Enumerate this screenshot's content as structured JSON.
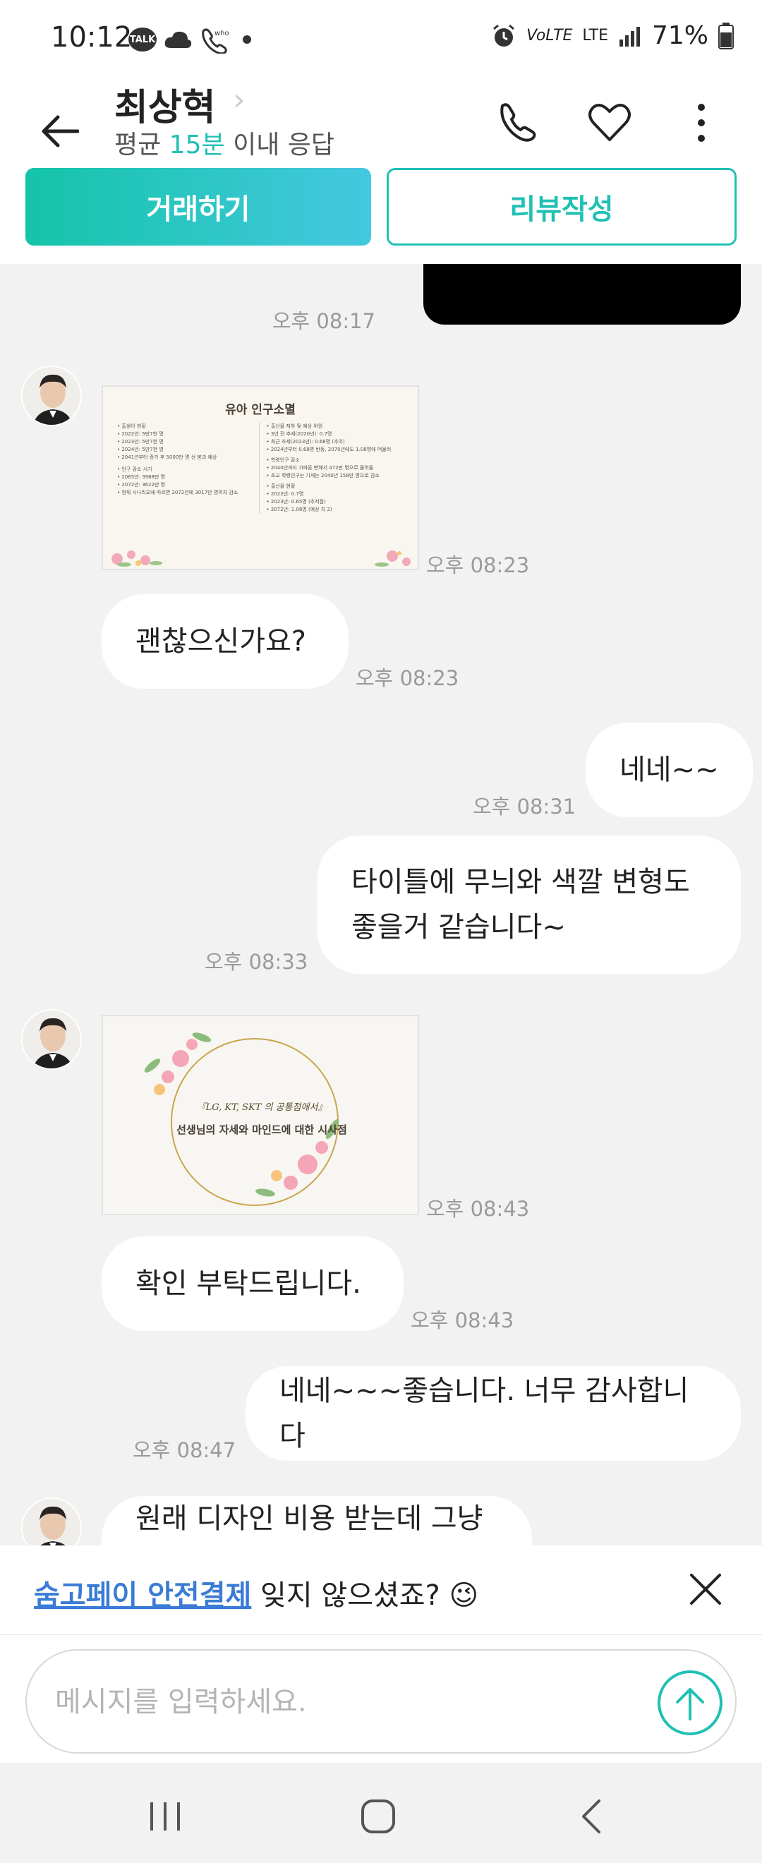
{
  "status_bar": {
    "time": "10:12",
    "talk_badge": "TALK",
    "battery": "71%",
    "network": "LTE",
    "volte": "VoLTE"
  },
  "header": {
    "name": "최상혁",
    "response_prefix": "평균 ",
    "response_time": "15분",
    "response_suffix": " 이내 응답",
    "deal_button": "거래하기",
    "review_button": "리뷰작성"
  },
  "messages": [
    {
      "side": "me",
      "type": "image-hidden",
      "time": "오후 08:17"
    },
    {
      "side": "other",
      "type": "image",
      "time": "오후 08:23",
      "image_title": "유아 인구소멸",
      "image_left": [
        "• 출생아 현황",
        "• 2022년: 5만7천 명",
        "• 2023년: 5만7천 명",
        "• 2024년: 5만7천 명",
        "• 2041년부터 증가 후 5000만 명 선 붕괴 예상",
        "• 인구 감소 시기",
        "• 2065년: 3968만 명",
        "• 2072년: 3622만 명",
        "• 현재 시나리오에 따르면 2072년에 3017만 명까지 감소"
      ],
      "image_right": [
        "• 출산율 저하 및 예상 위원",
        "• 3년 전 추세(2020년): 0.7명",
        "• 최근 추세(2023년): 0.68명 (추이)",
        "• 2024년부터 0.68명 반등, 2070년에도 1.08명에 머물러",
        "• 학령인구 감소",
        "• 2040년까지 가파른 변해서 472만 명으로 줄어들",
        "• 조교 학령인구는 기세는 2040년 158만 명으로 감소",
        "• 출산율 현황",
        "• 2022년: 0.7명",
        "• 2023년: 0.65명 (추저점)",
        "• 2072년: 1.08명 (예상 치 2)"
      ]
    },
    {
      "side": "other",
      "type": "text",
      "text": "괜찮으신가요?",
      "time": "오후 08:23"
    },
    {
      "side": "me",
      "type": "text",
      "text": "네네~~",
      "time": "오후 08:31"
    },
    {
      "side": "me",
      "type": "text",
      "text_line1": "타이틀에 무늬와 색깔 변형도",
      "text_line2": "좋을거 같습니다~",
      "time": "오후 08:33"
    },
    {
      "side": "other",
      "type": "image",
      "time": "오후 08:43",
      "image_line1": "『LG, KT, SKT 의 공통점에서』",
      "image_line2": "선생님의 자세와 마인드에 대한 시사점"
    },
    {
      "side": "other",
      "type": "text",
      "text": "확인 부탁드립니다.",
      "time": "오후 08:43"
    },
    {
      "side": "me",
      "type": "text",
      "text": "네네~~~좋습니다. 너무 감사합니다",
      "time": "오후 08:47"
    },
    {
      "side": "other",
      "type": "text",
      "text": "원래 디자인 비용 받는데 그냥",
      "time": ""
    }
  ],
  "banner": {
    "link": "숨고페이 안전결제",
    "text": " 잊지 않으셨죠? 😉"
  },
  "input": {
    "placeholder": "메시지를 입력하세요."
  },
  "colors": {
    "accent": "#20c0b4",
    "link": "#3a7bd5",
    "background": "#f2f2f2"
  }
}
